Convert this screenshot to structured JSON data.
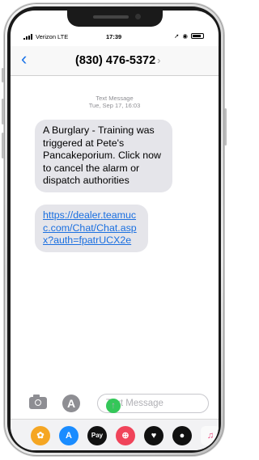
{
  "status_bar": {
    "carrier": "Verizon",
    "network": "LTE",
    "time": "17:39"
  },
  "header": {
    "back_icon": "chevron-left-icon",
    "contact": "(830) 476-5372",
    "contact_chevron": "›"
  },
  "conversation": {
    "meta_label": "Text Message",
    "meta_date": "Tue, Sep 17, 16:03",
    "messages": [
      {
        "text": "A Burglary - Training was triggered at Pete's Pancakeporium. Click now to cancel the alarm or dispatch authorities"
      },
      {
        "link": "https://​dealer.teamucc.com/​Chat/Chat.aspx?​auth=fpatrUCX2e"
      }
    ]
  },
  "compose": {
    "placeholder": "Text Message",
    "send_icon": "arrow-up-icon"
  },
  "dock": {
    "apps": [
      {
        "name": "photos-app-icon",
        "glyph": "✿",
        "color": "#f5a623"
      },
      {
        "name": "app-store-app-icon",
        "glyph": "A",
        "color": "#1a8cff"
      },
      {
        "name": "apple-pay-app-icon",
        "glyph": "Pay",
        "color": "#111111"
      },
      {
        "name": "search-images-app-icon",
        "glyph": "⊕",
        "color": "#f0445a"
      },
      {
        "name": "heart-app-icon",
        "glyph": "♥",
        "color": "#111111"
      },
      {
        "name": "camera-app-icon",
        "glyph": "●",
        "color": "#111111"
      },
      {
        "name": "music-app-icon",
        "glyph": "♫",
        "color": "#fafafa"
      }
    ]
  },
  "colors": {
    "accent": "#1a73e8",
    "bubble": "#e5e5ea",
    "send": "#34c759"
  }
}
